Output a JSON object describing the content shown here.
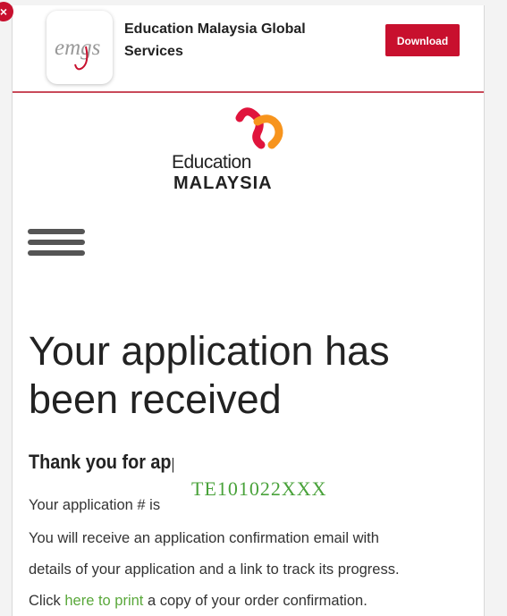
{
  "banner": {
    "app_icon_text": "emgs",
    "app_name": "Education Malaysia Global Services",
    "download_label": "Download",
    "close_glyph": "×",
    "accent_color": "#c8102e"
  },
  "logo": {
    "line1": "Education",
    "line2": "MALAYSIA",
    "colors": {
      "primary": "#e0143c",
      "secondary": "#f7941d"
    }
  },
  "menu": {
    "icon": "hamburger-icon"
  },
  "main": {
    "heading": "Your application has been received",
    "thanks": "Thank you for applying!",
    "application_label": "Your application # is",
    "application_number": "TE101022XXX",
    "confirmation_line1": "You will receive an application confirmation email with",
    "confirmation_line2": "details of your application and a link to track its progress.",
    "print_prefix": "Click ",
    "print_link": "here to print",
    "print_suffix": " a copy of your order confirmation.",
    "link_color": "#5aa83b"
  }
}
